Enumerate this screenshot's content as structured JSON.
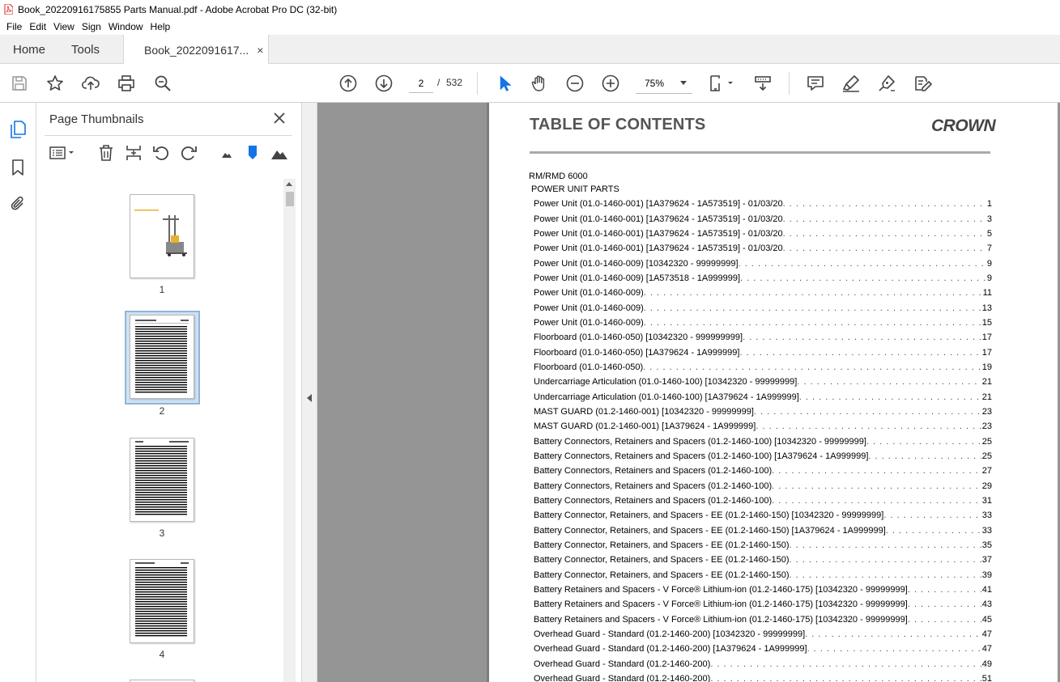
{
  "window": {
    "title": "Book_20220916175855 Parts Manual.pdf - Adobe Acrobat Pro DC (32-bit)"
  },
  "menu": [
    "File",
    "Edit",
    "View",
    "Sign",
    "Window",
    "Help"
  ],
  "tabs": {
    "home": "Home",
    "tools": "Tools",
    "document": "Book_2022091617...",
    "close_glyph": "×"
  },
  "toolbar": {
    "current_page": "2",
    "page_separator": "/",
    "total_pages": "532",
    "zoom": "75%"
  },
  "thumbnails_panel": {
    "title": "Page Thumbnails",
    "thumbnails": [
      {
        "number": "1"
      },
      {
        "number": "2"
      },
      {
        "number": "3"
      },
      {
        "number": "4"
      }
    ]
  },
  "document": {
    "heading": "TABLE OF CONTENTS",
    "logo_text": "CROWN",
    "model": "RM/RMD 6000",
    "section": "POWER UNIT PARTS",
    "toc": [
      {
        "title": "Power Unit (01.0-1460-001)  [1A379624 - 1A573519] - 01/03/20",
        "page": "1"
      },
      {
        "title": "Power Unit (01.0-1460-001)  [1A379624 - 1A573519] - 01/03/20",
        "page": "3"
      },
      {
        "title": "Power Unit (01.0-1460-001)  [1A379624 - 1A573519] - 01/03/20",
        "page": "5"
      },
      {
        "title": "Power Unit (01.0-1460-001)  [1A379624 - 1A573519] - 01/03/20",
        "page": "7"
      },
      {
        "title": "Power Unit (01.0-1460-009)  [10342320 - 99999999]",
        "page": "9"
      },
      {
        "title": "Power Unit (01.0-1460-009)  [1A573518 - 1A999999]",
        "page": "9"
      },
      {
        "title": "Power Unit (01.0-1460-009) ",
        "page": "11"
      },
      {
        "title": "Power Unit (01.0-1460-009) ",
        "page": "13"
      },
      {
        "title": "Power Unit (01.0-1460-009) ",
        "page": "15"
      },
      {
        "title": "Floorboard (01.0-1460-050)  [10342320 - 999999999]",
        "page": "17"
      },
      {
        "title": "Floorboard (01.0-1460-050)  [1A379624 - 1A999999]",
        "page": "17"
      },
      {
        "title": "Floorboard (01.0-1460-050) ",
        "page": "19"
      },
      {
        "title": "Undercarriage Articulation (01.0-1460-100)  [10342320 - 99999999]",
        "page": "21"
      },
      {
        "title": "Undercarriage Articulation (01.0-1460-100)  [1A379624 - 1A999999]",
        "page": "21"
      },
      {
        "title": "MAST GUARD (01.2-1460-001)  [10342320 - 99999999]",
        "page": "23"
      },
      {
        "title": "MAST GUARD (01.2-1460-001)  [1A379624 - 1A999999]",
        "page": "23"
      },
      {
        "title": "Battery Connectors, Retainers and Spacers (01.2-1460-100)  [10342320 - 99999999]",
        "page": "25"
      },
      {
        "title": "Battery Connectors, Retainers and Spacers (01.2-1460-100)  [1A379624 - 1A999999]",
        "page": "25"
      },
      {
        "title": "Battery Connectors, Retainers and Spacers (01.2-1460-100) ",
        "page": "27"
      },
      {
        "title": "Battery Connectors, Retainers and Spacers (01.2-1460-100) ",
        "page": "29"
      },
      {
        "title": "Battery Connectors, Retainers and Spacers (01.2-1460-100) ",
        "page": "31"
      },
      {
        "title": "Battery Connector, Retainers, and Spacers - EE (01.2-1460-150)  [10342320 - 99999999]",
        "page": "33"
      },
      {
        "title": "Battery Connector, Retainers, and Spacers - EE (01.2-1460-150)  [1A379624 - 1A999999]",
        "page": "33"
      },
      {
        "title": "Battery Connector, Retainers, and Spacers - EE (01.2-1460-150) ",
        "page": "35"
      },
      {
        "title": "Battery Connector, Retainers, and Spacers - EE (01.2-1460-150) ",
        "page": "37"
      },
      {
        "title": "Battery Connector, Retainers, and Spacers - EE (01.2-1460-150) ",
        "page": "39"
      },
      {
        "title": "Battery Retainers and Spacers - V Force® Lithium-ion (01.2-1460-175)  [10342320 - 99999999]",
        "page": "41"
      },
      {
        "title": "Battery Retainers and Spacers - V Force® Lithium-ion (01.2-1460-175)  [10342320 - 99999999]",
        "page": "43"
      },
      {
        "title": "Battery Retainers and Spacers - V Force® Lithium-ion (01.2-1460-175)  [10342320 - 99999999]",
        "page": "45"
      },
      {
        "title": "Overhead Guard - Standard (01.2-1460-200)  [10342320 - 99999999]",
        "page": "47"
      },
      {
        "title": "Overhead Guard - Standard (01.2-1460-200)  [1A379624 - 1A999999]",
        "page": "47"
      },
      {
        "title": "Overhead Guard - Standard (01.2-1460-200) ",
        "page": "49"
      },
      {
        "title": "Overhead Guard - Standard (01.2-1460-200) ",
        "page": "51"
      }
    ]
  },
  "colors": {
    "acrobat_red": "#d9231f",
    "selection_blue": "#cfe1f2",
    "select_tool_blue": "#1473e6",
    "bookmark_blue": "#1473e6"
  }
}
